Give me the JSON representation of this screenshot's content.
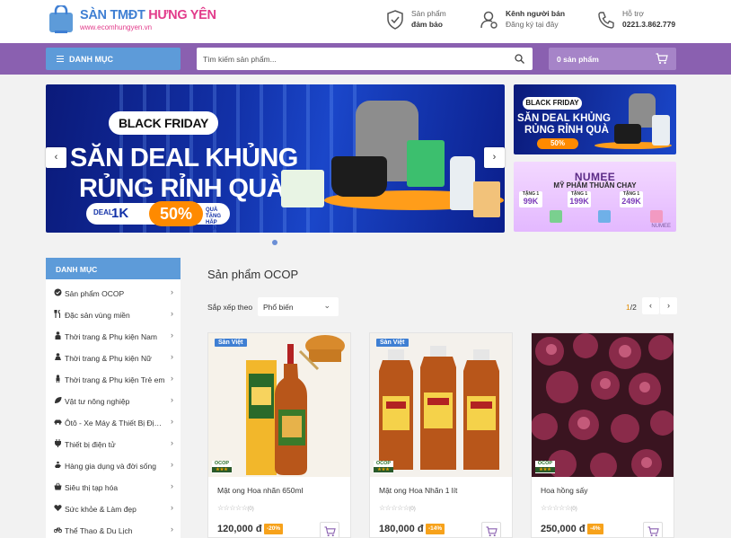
{
  "header": {
    "logo_title_main": "SÀN TMĐT",
    "logo_title_accent": "HƯNG YÊN",
    "logo_url": "www.ecomhungyen.vn",
    "features": [
      {
        "line1": "Sản phẩm",
        "line2": "đảm bảo",
        "icon": "shield-check-icon"
      },
      {
        "line1": "Kênh người bán",
        "line2": "Đăng ký tại đây",
        "icon": "user-gear-icon"
      },
      {
        "line1": "Hỗ trợ",
        "line2": "0221.3.862.779",
        "icon": "phone-icon"
      }
    ]
  },
  "navbar": {
    "category_label": "DANH MỤC",
    "search_placeholder": "Tìm kiếm sản phẩm...",
    "search_value": "",
    "cart_label": "0 sản phẩm",
    "accent": "#8a60b0",
    "category_bg": "#5d9bd9"
  },
  "banner": {
    "badge": "BLACK FRIDAY",
    "headline_1": "SĂN DEAL KHỦNG",
    "headline_2": "RỦNG RỈNH QUÀ",
    "deal_label": "DEAL",
    "deal_value": "1K",
    "deal_percent": "50%",
    "deal_note_1": "QUÀ TẶNG",
    "deal_note_2": "HẤP DẪN",
    "prev": "‹",
    "next": "›"
  },
  "side_banner_1": {
    "badge": "BLACK FRIDAY",
    "headline_1": "SĂN DEAL KHỦNG",
    "headline_2": "RỦNG RỈNH QUÀ",
    "percent": "50%"
  },
  "side_banner_2": {
    "brand": "NUMEE",
    "subtitle": "MỸ PHẨM THUẦN CHAY",
    "prices": [
      {
        "gift": "TẶNG 1",
        "value": "99K"
      },
      {
        "gift": "TẶNG 1",
        "value": "199K"
      },
      {
        "gift": "TẶNG 1",
        "value": "249K"
      }
    ],
    "footer": "NUMEE"
  },
  "sidebar": {
    "title": "DANH MỤC",
    "items": [
      {
        "label": "Sản phẩm OCOP",
        "icon": "badge-check-icon"
      },
      {
        "label": "Đặc sản vùng miền",
        "icon": "utensils-icon"
      },
      {
        "label": "Thời trang & Phụ kiện Nam",
        "icon": "man-icon"
      },
      {
        "label": "Thời trang & Phụ kiện Nữ",
        "icon": "woman-icon"
      },
      {
        "label": "Thời trang & Phụ kiện Trẻ em",
        "icon": "child-icon"
      },
      {
        "label": "Vật tư nông nghiệp",
        "icon": "leaf-icon"
      },
      {
        "label": "Ôtô - Xe Máy & Thiết Bị Định vị",
        "icon": "car-icon"
      },
      {
        "label": "Thiết bị điện tử",
        "icon": "plug-icon"
      },
      {
        "label": "Hàng gia dụng và đời sống",
        "icon": "hand-icon"
      },
      {
        "label": "Siêu thị tạp hóa",
        "icon": "basket-icon"
      },
      {
        "label": "Sức khỏe & Làm đẹp",
        "icon": "heart-icon"
      },
      {
        "label": "Thể Thao & Du Lịch",
        "icon": "bicycle-icon"
      }
    ]
  },
  "products": {
    "title": "Sản phẩm OCOP",
    "sort_label": "Sắp xếp theo",
    "sort_value": "Phổ biến",
    "page_current": "1",
    "page_total": "/2",
    "items": [
      {
        "name": "Mật ong Hoa nhãn 650ml",
        "price": "120,000 đ",
        "discount": "-20%",
        "tag": "Sàn Việt",
        "rating_count": "(0)",
        "ocop": "OCOP",
        "ocop_stars": "★★★"
      },
      {
        "name": "Mật ong Hoa Nhãn 1 lít",
        "price": "180,000 đ",
        "discount": "-14%",
        "tag": "Sàn Việt",
        "rating_count": "(0)",
        "ocop": "OCOP",
        "ocop_stars": "★★★"
      },
      {
        "name": "Hoa hồng sấy",
        "price": "250,000 đ",
        "discount": "-4%",
        "tag": "",
        "rating_count": "(0)",
        "ocop": "OCOP",
        "ocop_stars": "★★★"
      }
    ],
    "discount_color": "#f7a21b"
  }
}
